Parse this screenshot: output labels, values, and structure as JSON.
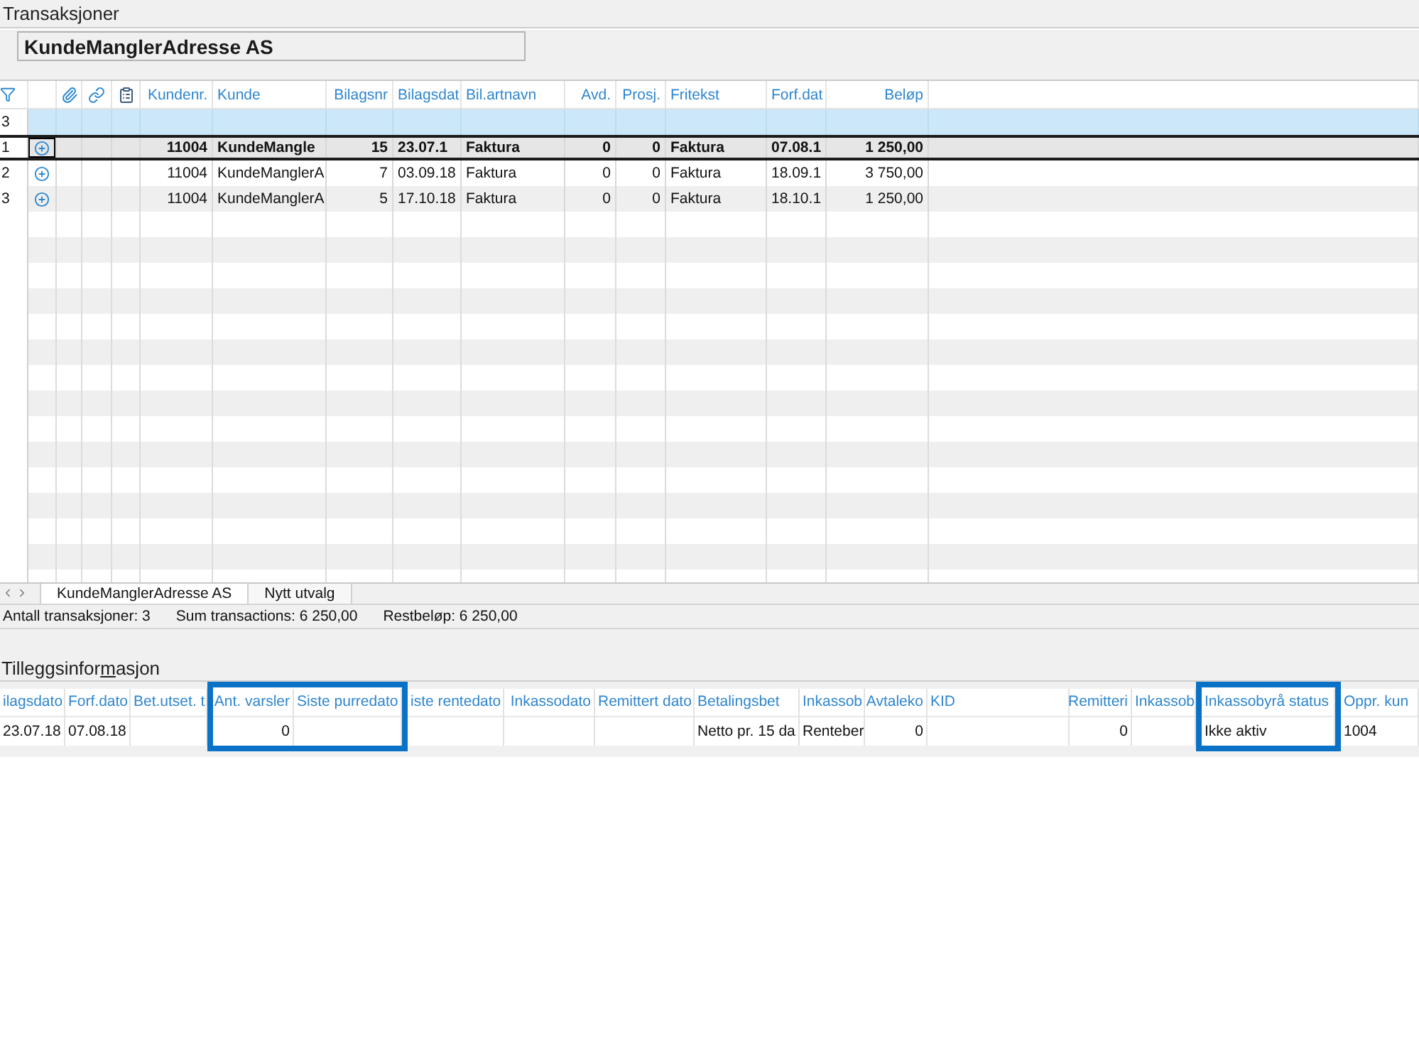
{
  "window": {
    "title": "Transaksjoner"
  },
  "customer_field": {
    "value": "KundeManglerAdresse AS"
  },
  "transactions_table": {
    "filter_row": {
      "row_label": "3"
    },
    "columns": [
      {
        "label": "Kundenr.",
        "kind": "number"
      },
      {
        "label": "Kunde",
        "kind": "text"
      },
      {
        "label": "Bilagsnr",
        "kind": "number"
      },
      {
        "label": "Bilagsdat",
        "kind": "text"
      },
      {
        "label": "Bil.artnavn",
        "kind": "text"
      },
      {
        "label": "Avd.",
        "kind": "number"
      },
      {
        "label": "Prosj.",
        "kind": "number"
      },
      {
        "label": "Fritekst",
        "kind": "text"
      },
      {
        "label": "Forf.dat",
        "kind": "text"
      },
      {
        "label": "Beløp",
        "kind": "number"
      }
    ],
    "rows": [
      {
        "row_label": "1",
        "selected": true,
        "cells": [
          "11004",
          "KundeMangle",
          "15",
          "23.07.1",
          "Faktura",
          "0",
          "0",
          "Faktura",
          "07.08.1",
          "1 250,00"
        ]
      },
      {
        "row_label": "2",
        "selected": false,
        "cells": [
          "11004",
          "KundeManglerA",
          "7",
          "03.09.18",
          "Faktura",
          "0",
          "0",
          "Faktura",
          "18.09.1",
          "3 750,00"
        ]
      },
      {
        "row_label": "3",
        "selected": false,
        "cells": [
          "11004",
          "KundeManglerA",
          "5",
          "17.10.18",
          "Faktura",
          "0",
          "0",
          "Faktura",
          "18.10.1",
          "1 250,00"
        ]
      }
    ]
  },
  "sheet_tabs": [
    {
      "label": "KundeManglerAdresse AS",
      "selected": true
    },
    {
      "label": "Nytt utvalg",
      "selected": false
    }
  ],
  "status_bar": [
    "Antall transaksjoner: 3",
    "Sum transactions: 6 250,00",
    "Restbeløp: 6 250,00"
  ],
  "additional_info": {
    "title": [
      {
        "text": "Tilleggsinfor",
        "underlined": false
      },
      {
        "text": "m",
        "underlined": true
      },
      {
        "text": "asjon",
        "underlined": false
      }
    ],
    "columns": [
      {
        "label": "ilagsdato",
        "kind": "text",
        "highlighted": false,
        "value": "23.07.18"
      },
      {
        "label": "Forf.dato",
        "kind": "text",
        "highlighted": false,
        "value": "07.08.18"
      },
      {
        "label": "Bet.utset. t",
        "kind": "text",
        "highlighted": false
      },
      {
        "label": "Ant. varsler",
        "kind": "number",
        "highlighted": true,
        "value": "0"
      },
      {
        "label": "Siste purredato",
        "kind": "text",
        "highlighted": true
      },
      {
        "label": "iste rentedato",
        "kind": "text",
        "highlighted": false
      },
      {
        "label": "Inkassodato",
        "kind": "number",
        "highlighted": false
      },
      {
        "label": "Remittert dato",
        "kind": "text",
        "highlighted": false
      },
      {
        "label": "Betalingsbet",
        "kind": "text",
        "highlighted": false,
        "value": "Netto pr. 15 da"
      },
      {
        "label": "Inkassob",
        "kind": "text",
        "highlighted": false,
        "value": "Renteber"
      },
      {
        "label": "Avtaleko",
        "kind": "number",
        "highlighted": false,
        "value": "0"
      },
      {
        "label": "KID",
        "kind": "text",
        "highlighted": false
      },
      {
        "label": "Remitteri",
        "kind": "number",
        "highlighted": false,
        "value": "0"
      },
      {
        "label": "Inkassob",
        "kind": "text",
        "highlighted": false
      },
      {
        "label": "Inkassobyrå status",
        "kind": "text",
        "highlighted": true,
        "value": "Ikke aktiv"
      },
      {
        "label": "Oppr. kun",
        "kind": "text",
        "highlighted": false,
        "value": "1004"
      }
    ]
  }
}
